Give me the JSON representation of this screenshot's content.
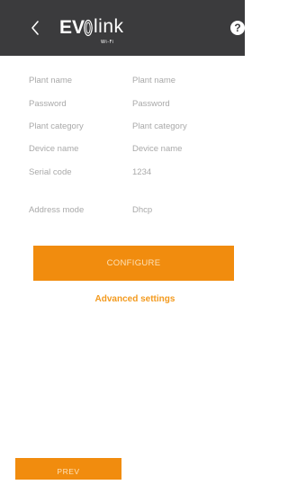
{
  "header": {
    "logo_ev": "EV",
    "logo_link": "link",
    "logo_wifi": "Wi-Fi",
    "help_label": "?"
  },
  "form": {
    "rows": [
      {
        "label": "Plant name",
        "value": "Plant name"
      },
      {
        "label": "Password",
        "value": "Password"
      },
      {
        "label": "Plant category",
        "value": "Plant category"
      },
      {
        "label": "Device name",
        "value": "Device name"
      },
      {
        "label": "Serial code",
        "value": "1234"
      },
      {
        "label": "Address mode",
        "value": "Dhcp"
      }
    ]
  },
  "actions": {
    "configure_label": "CONFIGURE",
    "advanced_label": "Advanced settings",
    "prev_label": "PREV"
  },
  "colors": {
    "header_bg": "#3b3b3d",
    "accent": "#f18c0e",
    "link": "#f39a1e",
    "text_muted": "#a9a9a9"
  },
  "icons": {
    "back": "chevron-left-icon",
    "help": "help-circle-icon"
  }
}
